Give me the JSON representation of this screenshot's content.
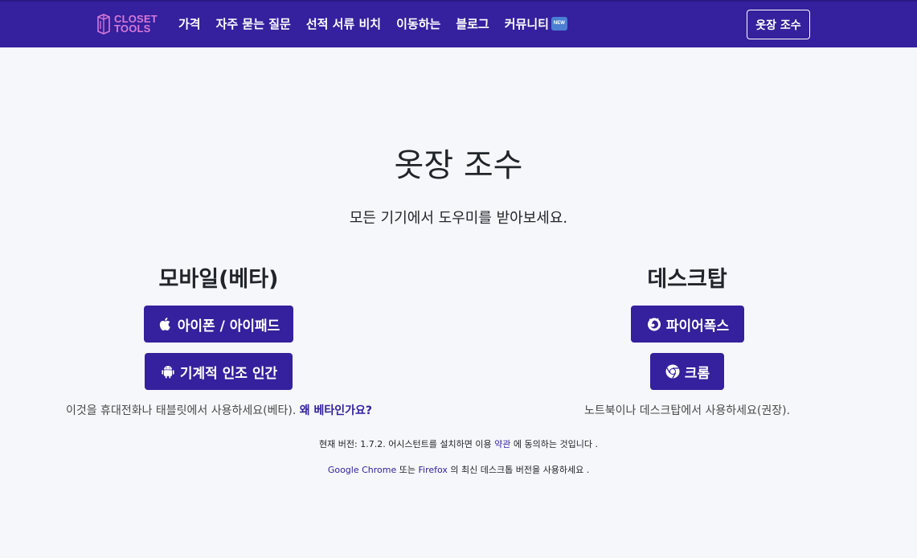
{
  "brand": {
    "logo_line1": "CLOSET",
    "logo_line2": "TOOLS",
    "accent_color": "#35209d",
    "logo_color": "#d67ad8"
  },
  "nav": {
    "links": [
      {
        "label": "가격"
      },
      {
        "label": "자주 묻는 질문"
      },
      {
        "label": "선적 서류 비치"
      },
      {
        "label": "이동하는"
      },
      {
        "label": "블로그"
      },
      {
        "label": "커뮤니티"
      }
    ],
    "new_badge": "NEW",
    "cta_label": "옷장 조수"
  },
  "main": {
    "title": "옷장 조수",
    "subtitle": "모든 기기에서 도우미를 받아보세요.",
    "mobile": {
      "heading": "모바일(베타)",
      "ios_button": "아이폰 / 아이패드",
      "android_button": "기계적 인조 인간",
      "note_text": "이것을 휴대전화나 태블릿에서 사용하세요(베타).",
      "note_link": "왜 베타인가요?"
    },
    "desktop": {
      "heading": "데스크탑",
      "firefox_button": "파이어폭스",
      "chrome_button": "크롬",
      "note_text": "노트북이나 데스크탑에서 사용하세요(권장)."
    }
  },
  "footer": {
    "version_prefix": "현재 버전: 1.7.2. 어시스턴트를 설치하면 이용",
    "terms_link": "약관",
    "version_suffix": "에 동의하는 것입니다 .",
    "chrome_link": "Google Chrome",
    "or_text": "또는",
    "firefox_link": "Firefox",
    "latest_suffix": "의 최신 데스크톱 버전을 사용하세요 ."
  }
}
